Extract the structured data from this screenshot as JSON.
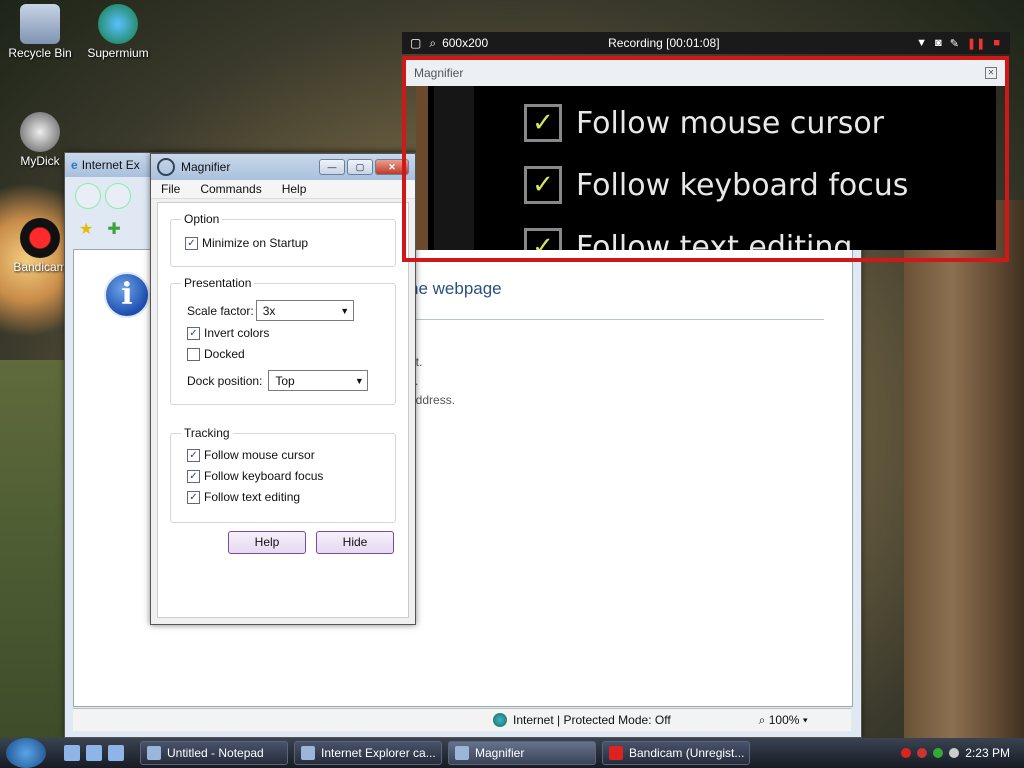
{
  "desktop": {
    "icons": [
      {
        "label": "Recycle Bin"
      },
      {
        "label": "Supermium"
      },
      {
        "label": "MyDick"
      },
      {
        "label": "Bandicam"
      }
    ]
  },
  "recorder": {
    "size": "600x200",
    "status": "Recording [00:01:08]"
  },
  "lens_window": {
    "title": "Magnifier",
    "lines": [
      "Follow mouse cursor",
      "Follow keyboard focus",
      "Follow text editing"
    ]
  },
  "ie_window": {
    "title": "Internet Ex",
    "heading": "he webpage",
    "lines": [
      "et.",
      "s.",
      "address."
    ],
    "status": "Internet | Protected Mode: Off",
    "zoom": "100%"
  },
  "magnifier": {
    "title": "Magnifier",
    "menu": [
      "File",
      "Commands",
      "Help"
    ],
    "option_group": "Option",
    "minimize_label": "Minimize on Startup",
    "presentation_group": "Presentation",
    "scale_label": "Scale factor:",
    "scale_value": "3x",
    "invert_label": "Invert colors",
    "docked_label": "Docked",
    "dock_label": "Dock position:",
    "dock_value": "Top",
    "tracking_group": "Tracking",
    "mouse_label": "Follow mouse cursor",
    "keyboard_label": "Follow keyboard focus",
    "text_label": "Follow text editing",
    "help_button": "Help",
    "hide_button": "Hide"
  },
  "taskbar": {
    "tasks": [
      "Untitled - Notepad",
      "Internet Explorer ca...",
      "Magnifier",
      "Bandicam (Unregist..."
    ],
    "time": "2:23 PM"
  }
}
